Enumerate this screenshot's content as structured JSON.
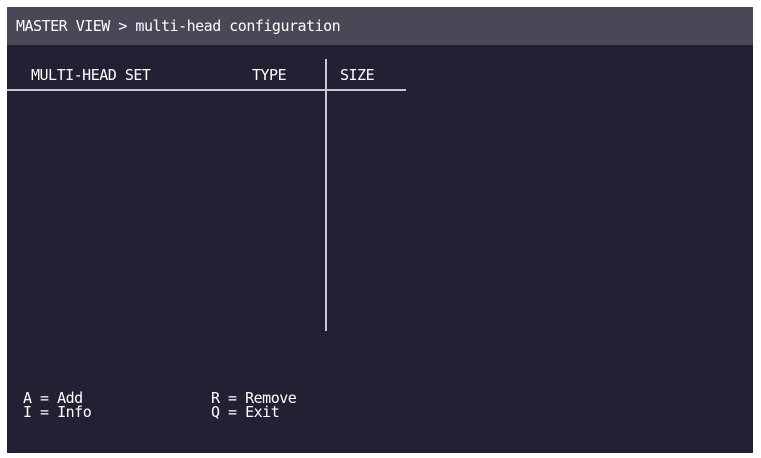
{
  "titlebar": {
    "title": "MASTER VIEW > multi-head configuration"
  },
  "table": {
    "columns": {
      "set": "MULTI-HEAD SET",
      "type": "TYPE",
      "size": "SIZE"
    },
    "rows": []
  },
  "footer": {
    "add": "A = Add",
    "info": "I = Info",
    "remove": "R = Remove",
    "exit": "Q = Exit"
  },
  "colors": {
    "background": "#232034",
    "titlebar": "#4a4856",
    "rule": "#c9c7d1",
    "text": "#ffffff"
  }
}
